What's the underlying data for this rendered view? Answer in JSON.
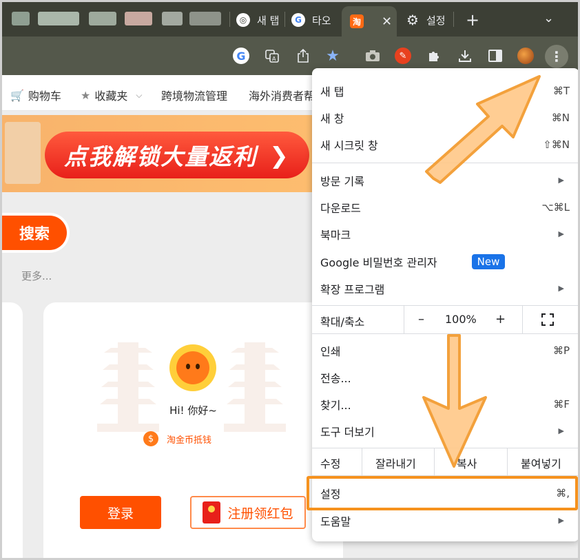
{
  "tabs": [
    {
      "label": "새 탭",
      "icon": "chrome-icon"
    },
    {
      "label": "타오",
      "icon": "google-icon"
    },
    {
      "label": "",
      "icon": "taobao-icon",
      "favicon_text": "淘"
    },
    {
      "label": "설정",
      "icon": "gear-icon"
    }
  ],
  "tab_close": "✕",
  "new_tab": "+",
  "toolbar": {
    "g_text": "G"
  },
  "bookmarks": [
    {
      "label": "购物车"
    },
    {
      "label": "收藏夹"
    },
    {
      "label": "跨境物流管理"
    },
    {
      "label": "海外消费者帮"
    }
  ],
  "page": {
    "banner_text": "点我解锁大量返利",
    "search_label": "搜索",
    "more_link": "更多...",
    "greeting": "Hi! 你好~",
    "coin_text": "淘金币抵钱",
    "coin_symbol": "$",
    "login_label": "登录",
    "signup_label": "注册领红包"
  },
  "menu": {
    "new_tab": {
      "label": "새 탭",
      "shortcut": "⌘T"
    },
    "new_window": {
      "label": "새 창",
      "shortcut": "⌘N"
    },
    "new_incognito": {
      "label": "새 시크릿 창",
      "shortcut": "⇧⌘N"
    },
    "history": {
      "label": "방문 기록"
    },
    "downloads": {
      "label": "다운로드",
      "shortcut": "⌥⌘L"
    },
    "bookmarks": {
      "label": "북마크"
    },
    "password_manager": {
      "label": "Google 비밀번호 관리자",
      "badge": "New"
    },
    "extensions": {
      "label": "확장 프로그램"
    },
    "zoom": {
      "label": "확대/축소",
      "minus": "–",
      "value": "100%",
      "plus": "+"
    },
    "print": {
      "label": "인쇄",
      "shortcut": "⌘P"
    },
    "cast": {
      "label": "전송..."
    },
    "find": {
      "label": "찾기...",
      "shortcut": "⌘F"
    },
    "more_tools": {
      "label": "도구 더보기"
    },
    "edit": {
      "label": "수정",
      "cut": "잘라내기",
      "copy": "복사",
      "paste": "붙여넣기"
    },
    "settings": {
      "label": "설정",
      "shortcut": "⌘,"
    },
    "help": {
      "label": "도움말"
    }
  },
  "colors": {
    "accent_orange": "#ff5000",
    "highlight": "#f6921e",
    "chrome_blue": "#1a73e8"
  }
}
